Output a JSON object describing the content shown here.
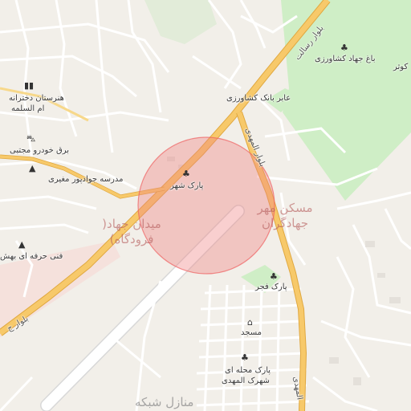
{
  "map": {
    "poi_labels": {
      "bagh_jahad": "باغ جهاد کشاورزی",
      "abir_bank": "عابر بانک کشاورزی",
      "kowsar": "کوثر",
      "honarestan_line1": "هنرستان دخترانه",
      "honarestan_line2": "ام السلمه",
      "barq_khodro": "برق خودرو مجتبی",
      "madrese": "مدرسه جوادپور مغیری",
      "park_shahr": "پارک شهر",
      "fanni_herfe": "فنی حرفه ای بهش",
      "park_fajr": "پارک فجر",
      "masjed": "مسجد",
      "park_mahalle_line1": "پارک محله ای",
      "park_mahalle_line2": "شهرک المهدی"
    },
    "area_labels": {
      "maskan_line1": "مسکن مهر",
      "maskan_line2": "جهادگران",
      "meydan_line1": "میدان جهاد(",
      "meydan_line2": "فرودگاه)",
      "manazel": "منازل شبکه"
    },
    "road_labels": {
      "resalat": "بلوار رسالت",
      "almahdi": "بلوار المهدی",
      "almahdi_south": "المهدی",
      "bolvar_sw": "بلوار ج"
    },
    "icons": {
      "garden": "tree-icon",
      "park": "tree-icon",
      "school": "school-icon",
      "car": "car-icon",
      "bank": "atm-icon",
      "mosque": "mosque-icon"
    },
    "colors": {
      "land": "#f2efe9",
      "green": "#cfeec6",
      "road_major": "#f7c96a",
      "road_minor": "#ffffff",
      "highlight_circle": "#f08080"
    }
  }
}
